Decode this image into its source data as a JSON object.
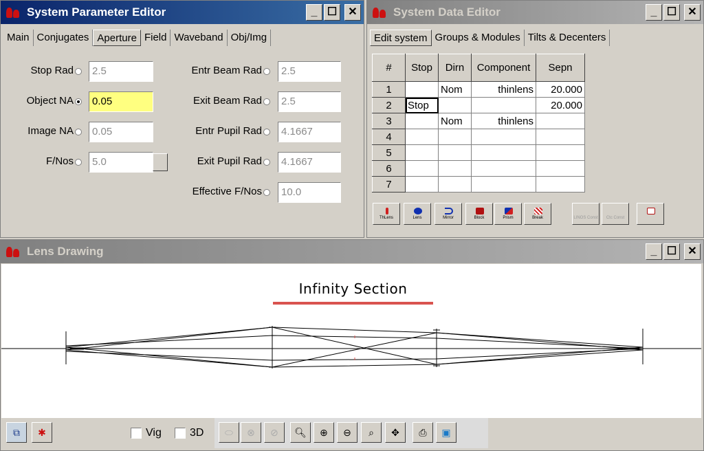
{
  "param_editor": {
    "title": "System Parameter Editor",
    "tabs": [
      "Main",
      "Conjugates",
      "Aperture",
      "Field",
      "Waveband",
      "Obj/Img"
    ],
    "left_fields": [
      {
        "label": "Stop Rad",
        "value": "2.5",
        "selected": false
      },
      {
        "label": "Object NA",
        "value": "0.05",
        "selected": true
      },
      {
        "label": "Image NA",
        "value": "0.05",
        "selected": false
      },
      {
        "label": "F/Nos",
        "value": "5.0",
        "selected": false
      }
    ],
    "right_fields": [
      {
        "label": "Entr Beam Rad",
        "value": "2.5"
      },
      {
        "label": "Exit Beam Rad",
        "value": "2.5"
      },
      {
        "label": "Entr Pupil Rad",
        "value": "4.1667"
      },
      {
        "label": "Exit Pupil Rad",
        "value": "4.1667"
      },
      {
        "label": "Effective F/Nos",
        "value": "10.0"
      }
    ]
  },
  "data_editor": {
    "title": "System Data Editor",
    "tabs": [
      "Edit system",
      "Groups & Modules",
      "Tilts & Decenters"
    ],
    "columns": [
      "#",
      "Stop",
      "Dirn",
      "Component",
      "Sepn"
    ],
    "rows": [
      {
        "n": "1",
        "stop": "",
        "dirn": "Nom",
        "component": "thinlens",
        "sepn": "20.000"
      },
      {
        "n": "2",
        "stop": "Stop",
        "dirn": "",
        "component": "",
        "sepn": "20.000"
      },
      {
        "n": "3",
        "stop": "",
        "dirn": "Nom",
        "component": "thinlens",
        "sepn": ""
      },
      {
        "n": "4",
        "stop": "",
        "dirn": "",
        "component": "",
        "sepn": ""
      },
      {
        "n": "5",
        "stop": "",
        "dirn": "",
        "component": "",
        "sepn": ""
      },
      {
        "n": "6",
        "stop": "",
        "dirn": "",
        "component": "",
        "sepn": ""
      },
      {
        "n": "7",
        "stop": "",
        "dirn": "",
        "component": "",
        "sepn": ""
      }
    ],
    "tools": [
      "ThLens",
      "Lens",
      "Mirror",
      "Block",
      "Prism",
      "Break",
      "LINOS Const",
      "Ctc Const"
    ]
  },
  "lens_drawing": {
    "title": "Lens Drawing",
    "section_title": "Infinity Section",
    "vig_label": "Vig",
    "three_d_label": "3D"
  },
  "colors": {
    "accent_red": "#d9534f",
    "highlight": "#ffff80"
  }
}
